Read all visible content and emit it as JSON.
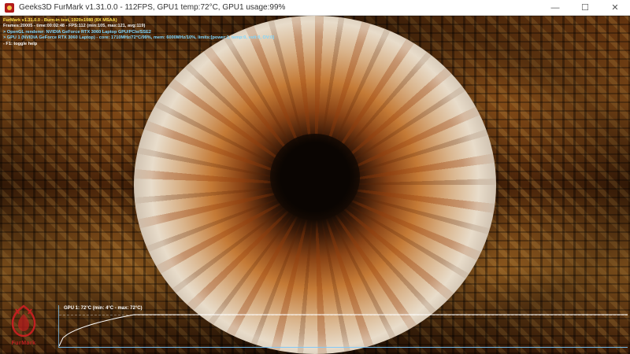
{
  "window": {
    "title": "Geeks3D FurMark v1.31.0.0 - 112FPS, GPU1 temp:72°C, GPU1 usage:99%",
    "controls": {
      "minimize": "—",
      "maximize": "☐",
      "close": "✕"
    }
  },
  "overlay": {
    "line1": "FurMark v1.31.0.0 - Burn-in test, 1920x1080 (8X MSAA)",
    "line2": "Frames:20005 - time:00:02:48 - FPS:112 (min:105, max:121, avg:119)",
    "line3": "> OpenGL renderer: NVIDIA GeForce RTX 3060 Laptop GPU/PCIe/SSE2",
    "line4": "> GPU 1 (NVIDIA GeForce RTX 3060 Laptop) - core: 1710MHz/72°C/99%, mem: 6000MHz/10%, limits:[power:1, temp:0, volt:0, OV:0]",
    "line5": "- F1: toggle help"
  },
  "graph": {
    "label": "GPU 1: 72°C (min: 4°C - max: 72°C)",
    "current_c": 72,
    "min_c": 4,
    "max_c": 72
  },
  "logo": {
    "text": "FurMark"
  },
  "colors": {
    "overlay_yellow": "#ffe24a",
    "overlay_cyan": "#7fd7ff",
    "graph_axis": "#78c8ff",
    "logo_red": "#c02020"
  }
}
